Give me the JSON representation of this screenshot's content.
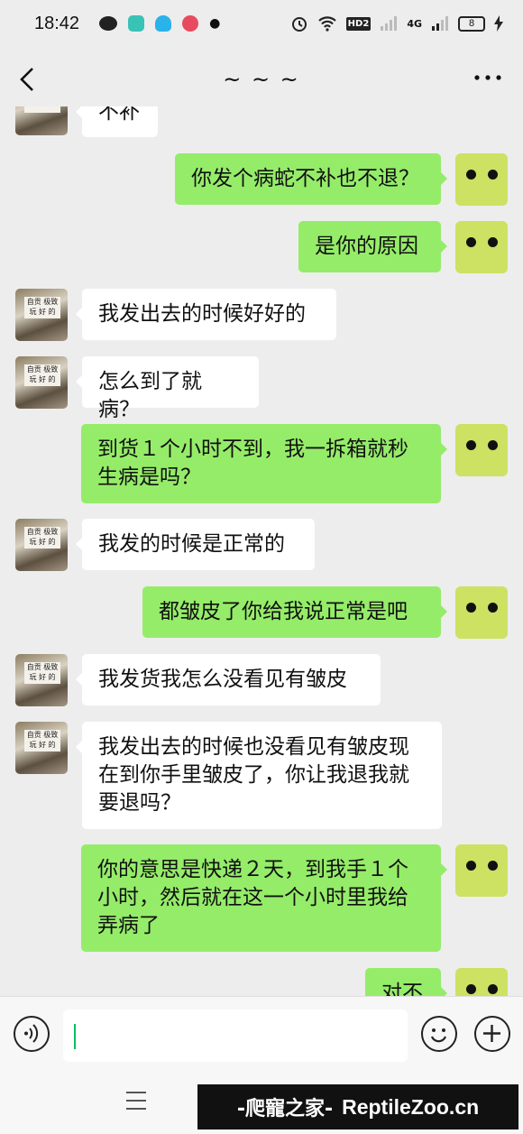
{
  "status_bar": {
    "time": "18:42",
    "network_label": "HD2",
    "network_type": "4G",
    "battery_level": "8"
  },
  "nav": {
    "title": "~ ~ ~"
  },
  "messages": [
    {
      "side": "left",
      "text": "不补"
    },
    {
      "side": "right",
      "text": "你发个病蛇不补也不退？"
    },
    {
      "side": "right",
      "text": "是你的原因"
    },
    {
      "side": "left",
      "text": "我发出去的时候好好的"
    },
    {
      "side": "left",
      "text": "怎么到了就病？"
    },
    {
      "side": "right",
      "text": "到货１个小时不到，我一拆箱就秒生病是吗？"
    },
    {
      "side": "left",
      "text": "我发的时候是正常的"
    },
    {
      "side": "right",
      "text": "都皱皮了你给我说正常是吧"
    },
    {
      "side": "left",
      "text": "我发货我怎么没看见有皱皮"
    },
    {
      "side": "left",
      "text": "我发出去的时候也没看见有皱皮现在到你手里皱皮了，你让我退我就要退吗？"
    },
    {
      "side": "right",
      "text": "你的意思是快递２天，到我手１个小时，然后就在这一个小时里我给弄病了"
    },
    {
      "side": "right",
      "text": "对不"
    }
  ],
  "avatar": {
    "left_plate_text": "自贡 极致 玩 好 的"
  },
  "input": {
    "value": ""
  },
  "watermark": {
    "brand": "-爬寵之家-",
    "site": "ReptileZoo.cn"
  },
  "colors": {
    "chat_bg": "#ededed",
    "bubble_self": "#95ec69",
    "bubble_other": "#ffffff",
    "avatar_self": "#cde162"
  }
}
